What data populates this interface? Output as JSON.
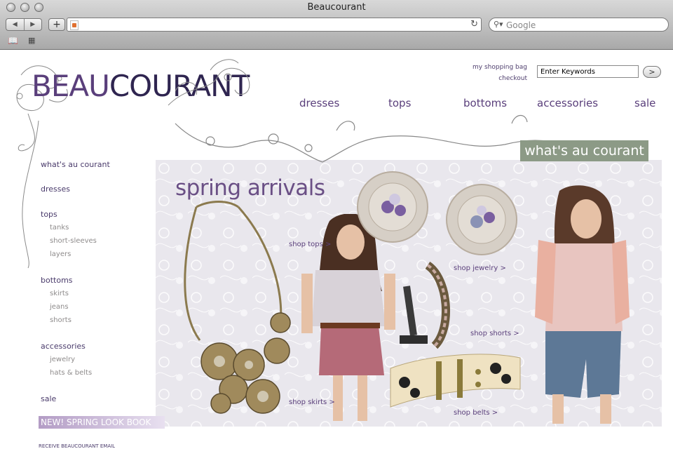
{
  "window": {
    "title": "Beaucourant"
  },
  "browser": {
    "search_placeholder": "Google",
    "url_value": ""
  },
  "logo": {
    "part1": "BEAU",
    "part2": "COURANT"
  },
  "header": {
    "shopping_bag": "my shopping bag",
    "checkout": "checkout",
    "search_value": "Enter Keywords",
    "search_go": ">"
  },
  "top_nav": [
    "dresses",
    "tops",
    "bottoms",
    "accessories",
    "sale"
  ],
  "banner": "what's au courant",
  "left_nav": {
    "whats_au_courant": "what's au courant",
    "dresses": "dresses",
    "tops": "tops",
    "tops_sub": [
      "tanks",
      "short-sleeves",
      "layers"
    ],
    "bottoms": "bottoms",
    "bottoms_sub": [
      "skirts",
      "jeans",
      "shorts"
    ],
    "accessories": "accessories",
    "accessories_sub": [
      "jewelry",
      "hats & belts"
    ],
    "sale": "sale",
    "lookbook": "NEW! SPRING LOOK BOOK",
    "receive": "RECEIVE BEAUCOURANT EMAIL"
  },
  "hero": {
    "title": "spring arrivals",
    "shop_tops": "shop tops >",
    "shop_jewelry": "shop jewelry >",
    "shop_shorts": "shop shorts >",
    "shop_skirts": "shop skirts >",
    "shop_belts": "shop belts >"
  },
  "colors": {
    "brand_purple": "#5a3f7b",
    "banner_green": "#8c9a86",
    "lookbook_lavender": "#b39cc5"
  }
}
